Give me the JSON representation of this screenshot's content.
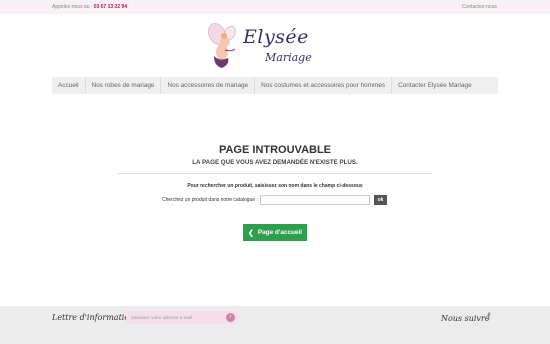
{
  "topbar": {
    "phone_prefix": "Appelez-nous au : ",
    "phone": "03 67 13 22 94",
    "contact": "Contactez-nous"
  },
  "logo": {
    "title": "Elysée",
    "subtitle": "Mariage"
  },
  "nav": {
    "items": [
      "Accueil",
      "Nos robes de mariage",
      "Nos accessoires de mariage",
      "Nos costumes et accessoires pour hommes",
      "Contacter Elysée Mariage"
    ]
  },
  "main": {
    "title": "PAGE INTROUVABLE",
    "subtitle": "LA PAGE QUE VOUS AVEZ DEMANDÉE N'EXISTE PLUS.",
    "instruction": "Pour rechercher un produit, saisissez son nom dans le champ ci-dessous",
    "search_label": "Cherchez un produit dans notre catalogue :",
    "search_value": "",
    "ok_label": "ok",
    "home_label": "Page d'accueil"
  },
  "footer": {
    "newsletter_label": "Lettre d'informations",
    "newsletter_placeholder": "Saisissez votre adresse e-mail",
    "follow_label": "Nous suivre"
  },
  "icons": {
    "home_chevron": "chevron-left-icon",
    "submit_arrow": "arrow-right-icon",
    "facebook": "facebook-icon"
  }
}
